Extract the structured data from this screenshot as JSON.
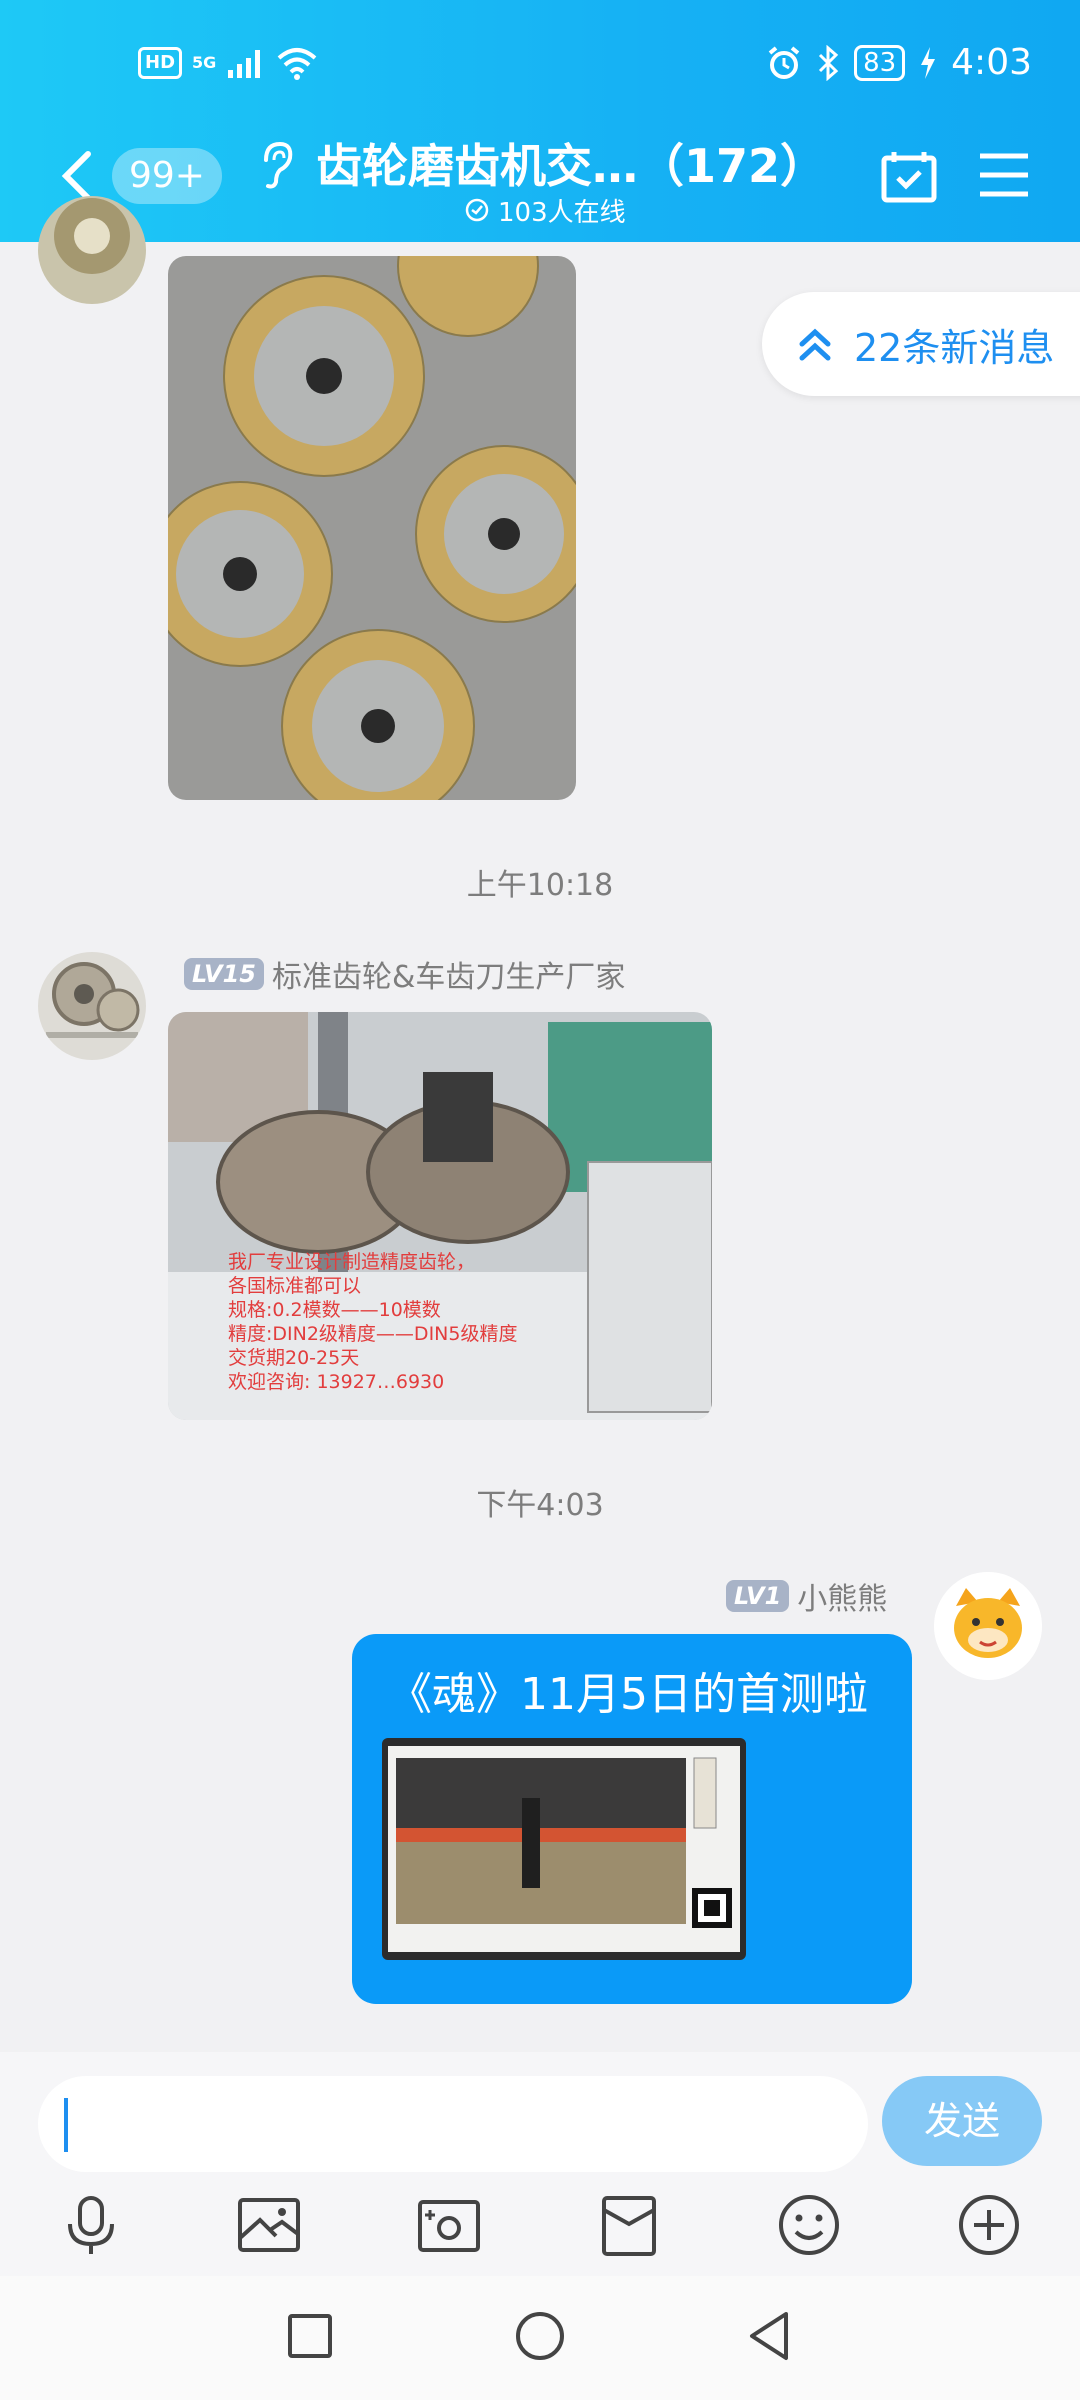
{
  "status_bar": {
    "hd": "HD",
    "network": "5G",
    "battery": "83",
    "time": "4:03"
  },
  "header": {
    "unread_count": "99+",
    "title": "齿轮磨齿机交…（172）",
    "online_text": "103人在线"
  },
  "new_messages": {
    "label": "22条新消息"
  },
  "messages": [
    {
      "type": "timestamp",
      "text": "上午10:18"
    },
    {
      "sender_level": "LV15",
      "sender_name": "标准齿轮&车齿刀生产厂家",
      "image_caption": [
        "我厂专业设计制造精度齿轮，",
        "各国标准都可以",
        "规格:0.2模数——10模数",
        "精度:DIN2级精度——DIN5级精度",
        "交货期20-25天",
        "欢迎咨询: 13927…6930"
      ]
    },
    {
      "type": "timestamp",
      "text": "下午4:03"
    },
    {
      "sender_level": "LV1",
      "sender_name": "小熊熊",
      "text": "《魂》11月5日的首测啦"
    }
  ],
  "input": {
    "value": "",
    "placeholder": "",
    "send_label": "发送"
  },
  "toolbar": {
    "icons": [
      "microphone-icon",
      "image-icon",
      "camera-icon",
      "red-packet-icon",
      "emoji-icon",
      "plus-icon"
    ]
  },
  "colors": {
    "header_gradient_start": "#1ec9f6",
    "header_gradient_end": "#10a8f2",
    "bubble_blue": "#0a9af8",
    "send_button": "#86c9f6",
    "link_blue": "#1e8ff0"
  }
}
